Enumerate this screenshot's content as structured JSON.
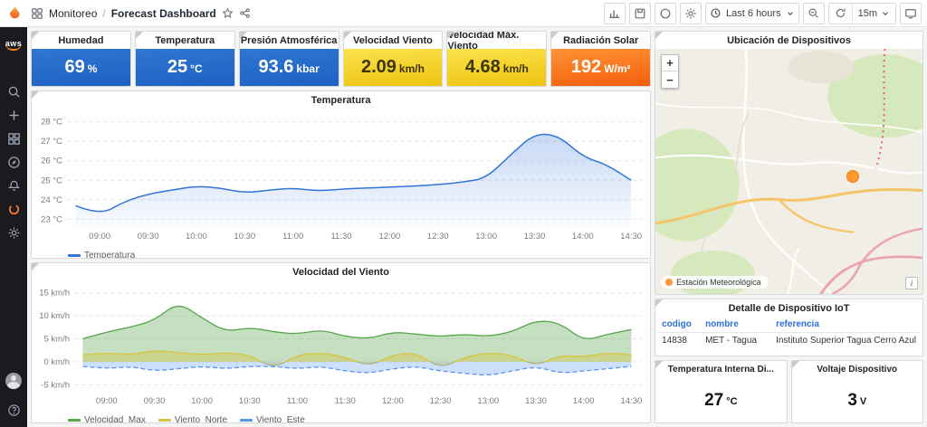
{
  "topbar": {
    "breadcrumb": {
      "app": "Monitoreo",
      "separator": "/",
      "page": "Forecast Dashboard"
    },
    "time_range_label": "Last 6 hours",
    "refresh_interval_label": "15m",
    "icons": [
      "grafana-logo",
      "apps-grid",
      "star",
      "share",
      "analytics",
      "save",
      "insights",
      "settings",
      "clock",
      "caret-down",
      "zoom-out",
      "refresh",
      "tv"
    ]
  },
  "sidebar": {
    "aws_label": "aws",
    "icons": [
      "search",
      "plus",
      "dashboards",
      "explore",
      "alerting",
      "grafana-ring",
      "settings"
    ],
    "bottom_icons": [
      "avatar",
      "help"
    ]
  },
  "stats": [
    {
      "title": "Humedad",
      "value": "69",
      "unit": "%",
      "bg": "blue"
    },
    {
      "title": "Temperatura",
      "value": "25",
      "unit": "°C",
      "bg": "blue"
    },
    {
      "title": "Presión Atmosférica",
      "value": "93.6",
      "unit": "kbar",
      "bg": "blue"
    },
    {
      "title": "Velocidad Viento",
      "value": "2.09",
      "unit": "km/h",
      "bg": "yellow"
    },
    {
      "title": "Velocidad Máx. Viento",
      "value": "4.68",
      "unit": "km/h",
      "bg": "yellow"
    },
    {
      "title": "Radiación Solar",
      "value": "192",
      "unit": "W/m²",
      "bg": "orange"
    }
  ],
  "chart_data": [
    {
      "id": "temperature",
      "type": "area",
      "title": "Temperatura",
      "x_hours": [
        8.75,
        9,
        9.25,
        9.5,
        9.75,
        10,
        10.25,
        10.5,
        10.75,
        11,
        11.25,
        11.5,
        11.75,
        12,
        12.25,
        12.5,
        12.75,
        13,
        13.25,
        13.5,
        13.75,
        14,
        14.25,
        14.5
      ],
      "xticks": [
        "09:00",
        "09:30",
        "10:00",
        "10:30",
        "11:00",
        "11:30",
        "12:00",
        "12:30",
        "13:00",
        "13:30",
        "14:00",
        "14:30"
      ],
      "xlim": [
        8.67,
        14.62
      ],
      "yticks": [
        23,
        24,
        25,
        26,
        27,
        28
      ],
      "y_unit": "°C",
      "ylim": [
        22.6,
        28.4
      ],
      "pad_left": 40,
      "series": [
        {
          "name": "Temperatura",
          "color": "#3274D9",
          "gradient": true,
          "fill_to": "bottom",
          "width": 1.5,
          "values": [
            23.7,
            23.2,
            23.9,
            24.3,
            24.5,
            24.7,
            24.6,
            24.35,
            24.5,
            24.6,
            24.45,
            24.55,
            24.6,
            24.65,
            24.7,
            24.78,
            24.9,
            25.1,
            26.3,
            27.4,
            27.3,
            26.2,
            25.8,
            25.0
          ]
        }
      ]
    },
    {
      "id": "wind",
      "type": "area",
      "title": "Velocidad del Viento",
      "x_hours": [
        8.75,
        9,
        9.25,
        9.5,
        9.75,
        10,
        10.25,
        10.5,
        10.75,
        11,
        11.25,
        11.5,
        11.75,
        12,
        12.25,
        12.5,
        12.75,
        13,
        13.25,
        13.5,
        13.75,
        14,
        14.25,
        14.5
      ],
      "xticks": [
        "09:00",
        "09:30",
        "10:00",
        "10:30",
        "11:00",
        "11:30",
        "12:00",
        "12:30",
        "13:00",
        "13:30",
        "14:00",
        "14:30"
      ],
      "xlim": [
        8.67,
        14.62
      ],
      "yticks": [
        -5,
        0,
        5,
        10,
        15
      ],
      "y_unit": "km/h",
      "ylim": [
        -6.5,
        16.5
      ],
      "pad_left": 48,
      "series": [
        {
          "name": "Velocidad_Max",
          "color": "#56A64B",
          "fill_opacity": 0.35,
          "fill_to": 0,
          "width": 1.3,
          "values": [
            5,
            6.5,
            7.5,
            9,
            13,
            9.5,
            6.5,
            7.5,
            6.5,
            6,
            7,
            5.5,
            5,
            6.5,
            6,
            5.5,
            6,
            5.5,
            6.5,
            9,
            8.5,
            4.5,
            6,
            7
          ]
        },
        {
          "name": "Viento_Norte",
          "color": "#D8C33F",
          "fill_opacity": 0.4,
          "fill_to": 0,
          "width": 1.3,
          "values": [
            1.5,
            2,
            1.5,
            2.5,
            2,
            1.5,
            2,
            1.5,
            -1.5,
            1.5,
            2,
            1,
            -1,
            1.5,
            2,
            -1.5,
            1,
            2,
            1.5,
            -1,
            1.5,
            1,
            2,
            1.5
          ]
        },
        {
          "name": "Viento_Este",
          "color": "#5794F2",
          "fill_opacity": 0.3,
          "fill_to": 0,
          "dash": true,
          "width": 1.3,
          "values": [
            -1,
            -1.5,
            -1,
            -2,
            -1.5,
            -1,
            -1.5,
            -1,
            -1,
            -1.5,
            -1,
            -2,
            -2.5,
            -1.5,
            -1,
            -2,
            -2.5,
            -3,
            -2,
            -1,
            -2.5,
            -2,
            -1.5,
            -1
          ]
        }
      ]
    }
  ],
  "map_panel": {
    "title": "Ubicación de Dispositivos",
    "zoom_in_label": "+",
    "zoom_out_label": "−",
    "legend_label": "Estación Meteorológica",
    "legend_color": "#FF9830",
    "attribution_label": "i",
    "marker": {
      "left_pct": 74,
      "top_pct": 52,
      "color": "#FF9830"
    }
  },
  "device_table": {
    "title": "Detalle de Dispositivo IoT",
    "headers": [
      "codigo",
      "nombre",
      "referencia"
    ],
    "rows": [
      [
        "14838",
        "MET - Tagua",
        "Instituto Superior Tagua Cerro Azul"
      ]
    ]
  },
  "bottom_stats": [
    {
      "title": "Temperatura Interna Di...",
      "value": "27",
      "unit": "°C"
    },
    {
      "title": "Voltaje Dispositivo",
      "value": "3",
      "unit": "V"
    }
  ]
}
